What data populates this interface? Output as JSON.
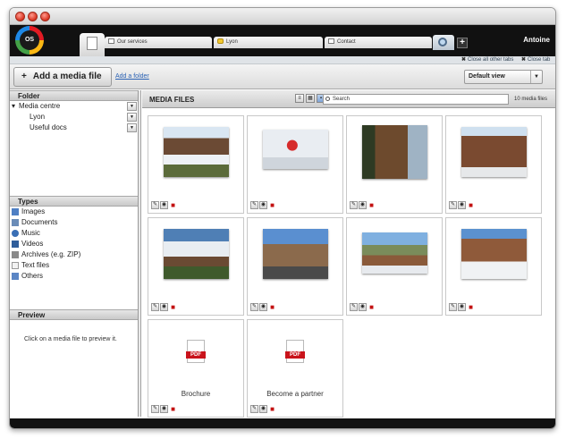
{
  "app": {
    "logo_text": "OS",
    "user": "Antoine"
  },
  "tabs": [
    {
      "label": "Our services",
      "icon": "page-icon"
    },
    {
      "label": "Lyon",
      "icon": "folder-icon"
    },
    {
      "label": "Contact",
      "icon": "checkbox-icon"
    }
  ],
  "tab_actions": {
    "close_others": "Close all other tabs",
    "close_tab": "Close tab"
  },
  "toolbar": {
    "add_media": "Add a media file",
    "add_folder": "Add a folder",
    "view": "Default view"
  },
  "sidebar": {
    "folder_title": "Folder",
    "folders": [
      {
        "label": "Media centre",
        "level": 0
      },
      {
        "label": "Lyon",
        "level": 1
      },
      {
        "label": "Useful docs",
        "level": 1
      }
    ],
    "types_title": "Types",
    "types": [
      {
        "label": "Images",
        "icon": "images-icon",
        "color": "#4e7fc4"
      },
      {
        "label": "Documents",
        "icon": "documents-icon",
        "color": "#6a8cb8"
      },
      {
        "label": "Music",
        "icon": "music-icon",
        "color": "#3a6fb5"
      },
      {
        "label": "Videos",
        "icon": "videos-icon",
        "color": "#2f5d9a"
      },
      {
        "label": "Archives (e.g. ZIP)",
        "icon": "archive-icon",
        "color": "#8a8a8a"
      },
      {
        "label": "Text files",
        "icon": "text-file-icon",
        "color": "#dddddd"
      },
      {
        "label": "Others",
        "icon": "others-icon",
        "color": "#5b86c5"
      }
    ],
    "preview_title": "Preview",
    "preview_hint": "Click on a media file to preview it."
  },
  "main": {
    "title": "MEDIA FILES",
    "search_placeholder": "Search",
    "count": "10 media files"
  },
  "media": [
    {
      "kind": "image",
      "scene": "chalet"
    },
    {
      "kind": "image",
      "scene": "snowboard"
    },
    {
      "kind": "image",
      "scene": "building"
    },
    {
      "kind": "image",
      "scene": "wooden-chalet"
    },
    {
      "kind": "image",
      "scene": "snowy-chalet"
    },
    {
      "kind": "image",
      "scene": "village"
    },
    {
      "kind": "image",
      "scene": "mountain-chalet"
    },
    {
      "kind": "image",
      "scene": "hotel-sign"
    },
    {
      "kind": "pdf",
      "name": "Brochure",
      "badge": "PDF"
    },
    {
      "kind": "pdf",
      "name": "Become a partner",
      "badge": "PDF"
    }
  ]
}
